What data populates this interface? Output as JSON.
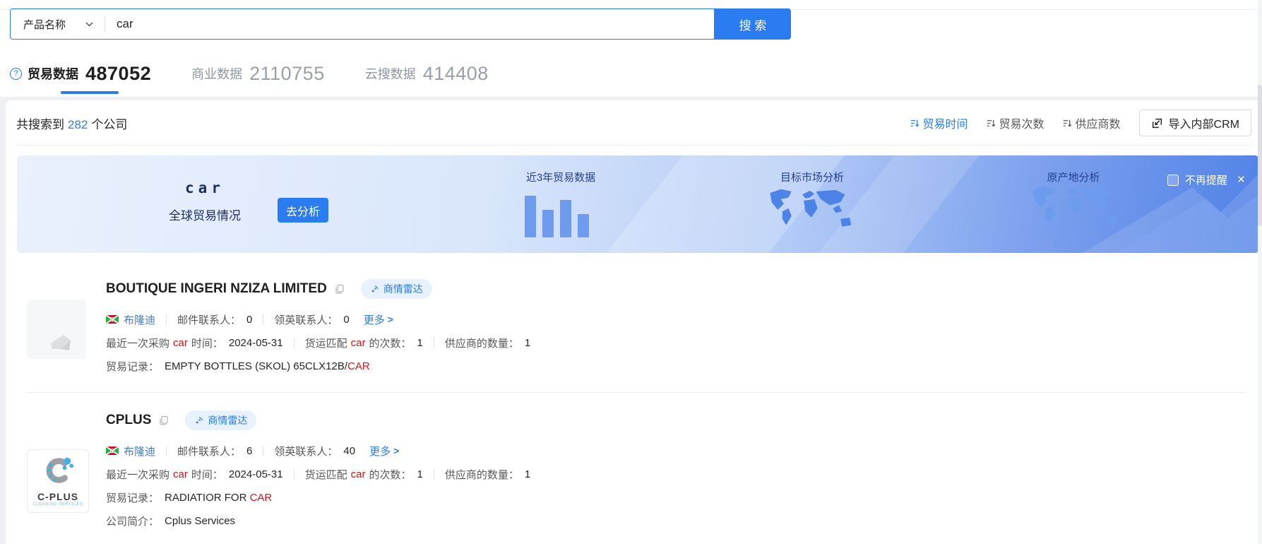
{
  "search": {
    "category": "产品名称",
    "value": "car",
    "button_label": "搜 索"
  },
  "icons": {
    "help_glyph": "?",
    "close_glyph": "×",
    "chevron_right": ">"
  },
  "tabs": [
    {
      "label": "贸易数据",
      "count": "487052",
      "active": true
    },
    {
      "label": "商业数据",
      "count": "2110755",
      "active": false
    },
    {
      "label": "云搜数据",
      "count": "414408",
      "active": false
    }
  ],
  "results": {
    "prefix": "共搜索到",
    "count": "282",
    "suffix": "个公司",
    "sorts": [
      {
        "label": "贸易时间",
        "active": true
      },
      {
        "label": "贸易次数",
        "active": false
      },
      {
        "label": "供应商数",
        "active": false
      }
    ],
    "crm_button": "导入内部CRM"
  },
  "banner": {
    "keyword": "car",
    "subtitle": "全球贸易情况",
    "analyze_button": "去分析",
    "chart_title": "近3年贸易数据",
    "chart_bars": [
      59,
      39,
      53,
      33
    ],
    "market_title": "目标市场分析",
    "origin_title": "原产地分析",
    "dismiss_label": "不再提醒"
  },
  "companies": [
    {
      "name": "BOUTIQUE INGERI NZIZA LIMITED",
      "badge": "商情雷达",
      "country": "布隆迪",
      "email_label": "邮件联系人：",
      "email_count": "0",
      "linkedin_label": "领英联系人：",
      "linkedin_count": "0",
      "more_label": "更多",
      "purchase_label_pre": "最近一次采购",
      "purchase_keyword": "car",
      "purchase_label_post": "时间：",
      "purchase_date": "2024-05-31",
      "freight_label_pre": "货运匹配",
      "freight_keyword": "car",
      "freight_label_post": "的次数：",
      "freight_count": "1",
      "supplier_label": "供应商的数量：",
      "supplier_count": "1",
      "record_label": "贸易记录：",
      "record_text": "EMPTY BOTTLES (SKOL) 65CLX12B/",
      "record_keyword": "CAR"
    },
    {
      "name": "CPLUS",
      "badge": "商情雷达",
      "country": "布隆迪",
      "email_label": "邮件联系人：",
      "email_count": "6",
      "linkedin_label": "领英联系人：",
      "linkedin_count": "40",
      "more_label": "更多",
      "purchase_label_pre": "最近一次采购",
      "purchase_keyword": "car",
      "purchase_label_post": "时间：",
      "purchase_date": "2024-05-31",
      "freight_label_pre": "货运匹配",
      "freight_keyword": "car",
      "freight_label_post": "的次数：",
      "freight_count": "1",
      "supplier_label": "供应商的数量：",
      "supplier_count": "1",
      "record_label": "贸易记录：",
      "record_text": "RADIATIOR FOR ",
      "record_keyword": "CAR",
      "intro_label": "公司简介：",
      "intro_text": "Cplus Services",
      "logo_name": "C-PLUS",
      "logo_sub": "CLEANING SERVICES"
    }
  ],
  "colors": {
    "primary": "#2b7cf0",
    "keyword_red": "#e01515",
    "banner_label": "#27408f"
  }
}
